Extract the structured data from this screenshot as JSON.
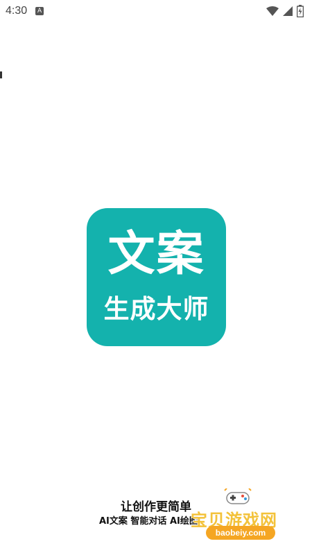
{
  "status_bar": {
    "time": "4:30",
    "notification_badge": "A",
    "icons": [
      "wifi-icon",
      "signal-icon",
      "battery-icon"
    ]
  },
  "logo": {
    "title": "文案",
    "subtitle": "生成大师",
    "color": "#14b2ad"
  },
  "footer": {
    "slogan": "让创作更简单",
    "features": "AI文案  智能对话  AI绘图"
  },
  "watermark": {
    "brand": "宝贝游戏网",
    "url": "baobeiy.com",
    "icon": "gamepad-icon"
  }
}
